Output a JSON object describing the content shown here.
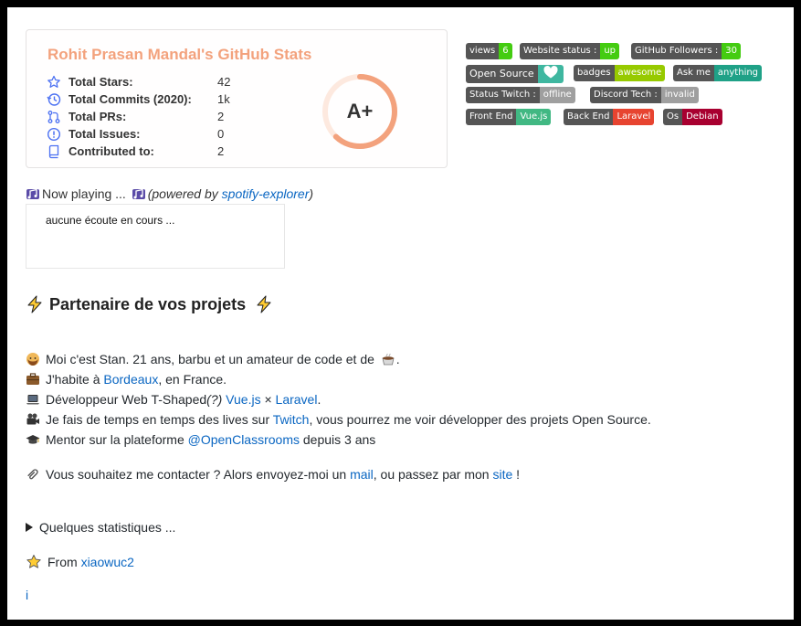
{
  "stats": {
    "title": "Rohit Prasan Mandal's GitHub Stats",
    "rows": [
      {
        "icon": "star-icon",
        "label": "Total Stars:",
        "value": "42"
      },
      {
        "icon": "history-icon",
        "label": "Total Commits (2020):",
        "value": "1k"
      },
      {
        "icon": "pull-request-icon",
        "label": "Total PRs:",
        "value": "2"
      },
      {
        "icon": "issue-icon",
        "label": "Total Issues:",
        "value": "0"
      },
      {
        "icon": "repo-icon",
        "label": "Contributed to:",
        "value": "2"
      }
    ],
    "rank": "A+",
    "rank_progress": 0.62
  },
  "badges": [
    {
      "left": "views",
      "right": "6",
      "color": "#4c1"
    },
    {
      "left": "Website status :",
      "right": "up",
      "color": "#4c1"
    },
    {
      "left": "GitHub Followers :",
      "right": "30",
      "color": "#4c1"
    },
    {
      "left": "Open Source",
      "right": "heart-icon",
      "color": "#3fb7a0"
    },
    {
      "left": "badges",
      "right": "awesome",
      "color": "#97ca00"
    },
    {
      "left": "Ask me",
      "right": "anything",
      "color": "#1fa187"
    },
    {
      "left": "Status Twitch :",
      "right": "offline",
      "color": "#9f9f9f"
    },
    {
      "left": "Discord Tech :",
      "right": "invalid",
      "color": "#9f9f9f"
    },
    {
      "left": "Front End",
      "right": "Vue.js",
      "color": "#41b883"
    },
    {
      "left": "Back End",
      "right": "Laravel",
      "color": "#e74430"
    },
    {
      "left": "Os",
      "right": "Debian",
      "color": "#a80030"
    }
  ],
  "now_playing": {
    "prefix": "Now playing ...",
    "powered_pre": "(powered by ",
    "powered_link": "spotify-explorer",
    "powered_post": ")",
    "status": "aucune écoute en cours ..."
  },
  "heading": "Partenaire de vos projets",
  "intro": {
    "l1": "Moi c'est Stan. 21 ans, barbu et un amateur de code et de",
    "l1_end": ".",
    "l2_pre": "J'habite à ",
    "l2_link": "Bordeaux",
    "l2_post": ", en France.",
    "l3_pre": "Développeur Web T-Shaped",
    "l3_q": "(?)",
    "l3_link1": "Vue.js",
    "l3_x": " × ",
    "l3_link2": "Laravel",
    "l3_post": ".",
    "l4_pre": "Je fais de temps en temps des lives sur ",
    "l4_link": "Twitch",
    "l4_post": ", vous pourrez me voir développer des projets Open Source.",
    "l5_pre": "Mentor sur la plateforme ",
    "l5_link": "@OpenClassrooms",
    "l5_post": " depuis 3 ans"
  },
  "contact": {
    "pre": "Vous souhaitez me contacter ? Alors envoyez-moi un ",
    "link1": "mail",
    "mid": ", ou passez par mon ",
    "link2": "site",
    "post": " !"
  },
  "details": "Quelques statistiques ...",
  "from": {
    "pre": "From ",
    "link": "xiaowuc2"
  },
  "footer_link": "i"
}
